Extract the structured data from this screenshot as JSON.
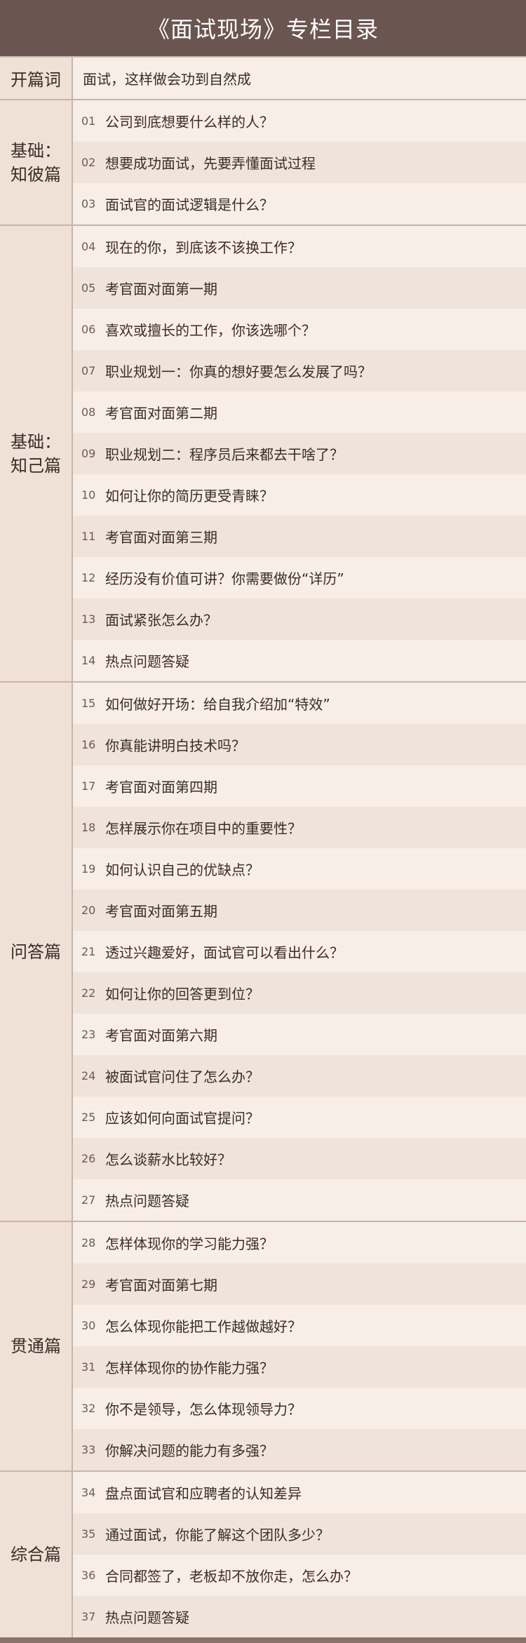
{
  "title": "《面试现场》专栏目录",
  "intro": {
    "label": "开篇词",
    "text": "面试，这样做会功到自然成"
  },
  "sections": [
    {
      "label": "基础：\n知彼篇",
      "items": [
        {
          "num": "01",
          "text": "公司到底想要什么样的人？"
        },
        {
          "num": "02",
          "text": "想要成功面试，先要弄懂面试过程"
        },
        {
          "num": "03",
          "text": "面试官的面试逻辑是什么？"
        }
      ]
    },
    {
      "label": "基础：\n知己篇",
      "items": [
        {
          "num": "04",
          "text": "现在的你，到底该不该换工作？"
        },
        {
          "num": "05",
          "text": "考官面对面第一期"
        },
        {
          "num": "06",
          "text": "喜欢或擅长的工作，你该选哪个？"
        },
        {
          "num": "07",
          "text": "职业规划一：你真的想好要怎么发展了吗？"
        },
        {
          "num": "08",
          "text": "考官面对面第二期"
        },
        {
          "num": "09",
          "text": "职业规划二：程序员后来都去干啥了？"
        },
        {
          "num": "10",
          "text": "如何让你的简历更受青睐？"
        },
        {
          "num": "11",
          "text": "考官面对面第三期"
        },
        {
          "num": "12",
          "text": "经历没有价值可讲？你需要做份“详历”"
        },
        {
          "num": "13",
          "text": "面试紧张怎么办？"
        },
        {
          "num": "14",
          "text": "热点问题答疑"
        }
      ]
    },
    {
      "label": "问答篇",
      "items": [
        {
          "num": "15",
          "text": "如何做好开场：给自我介绍加“特效”"
        },
        {
          "num": "16",
          "text": "你真能讲明白技术吗？"
        },
        {
          "num": "17",
          "text": "考官面对面第四期"
        },
        {
          "num": "18",
          "text": "怎样展示你在项目中的重要性？"
        },
        {
          "num": "19",
          "text": "如何认识自己的优缺点？"
        },
        {
          "num": "20",
          "text": "考官面对面第五期"
        },
        {
          "num": "21",
          "text": "透过兴趣爱好，面试官可以看出什么？"
        },
        {
          "num": "22",
          "text": "如何让你的回答更到位？"
        },
        {
          "num": "23",
          "text": "考官面对面第六期"
        },
        {
          "num": "24",
          "text": "被面试官问住了怎么办？"
        },
        {
          "num": "25",
          "text": "应该如何向面试官提问？"
        },
        {
          "num": "26",
          "text": "怎么谈薪水比较好？"
        },
        {
          "num": "27",
          "text": "热点问题答疑"
        }
      ]
    },
    {
      "label": "贯通篇",
      "items": [
        {
          "num": "28",
          "text": "怎样体现你的学习能力强？"
        },
        {
          "num": "29",
          "text": "考官面对面第七期"
        },
        {
          "num": "30",
          "text": "怎么体现你能把工作越做越好？"
        },
        {
          "num": "31",
          "text": "怎样体现你的协作能力强？"
        },
        {
          "num": "32",
          "text": "你不是领导，怎么体现领导力？"
        },
        {
          "num": "33",
          "text": "你解决问题的能力有多强？"
        }
      ]
    },
    {
      "label": "综合篇",
      "items": [
        {
          "num": "34",
          "text": "盘点面试官和应聘者的认知差异"
        },
        {
          "num": "35",
          "text": "通过面试，你能了解这个团队多少？"
        },
        {
          "num": "36",
          "text": "合同都签了，老板却不放你走，怎么办？"
        },
        {
          "num": "37",
          "text": "热点问题答疑"
        }
      ]
    }
  ]
}
